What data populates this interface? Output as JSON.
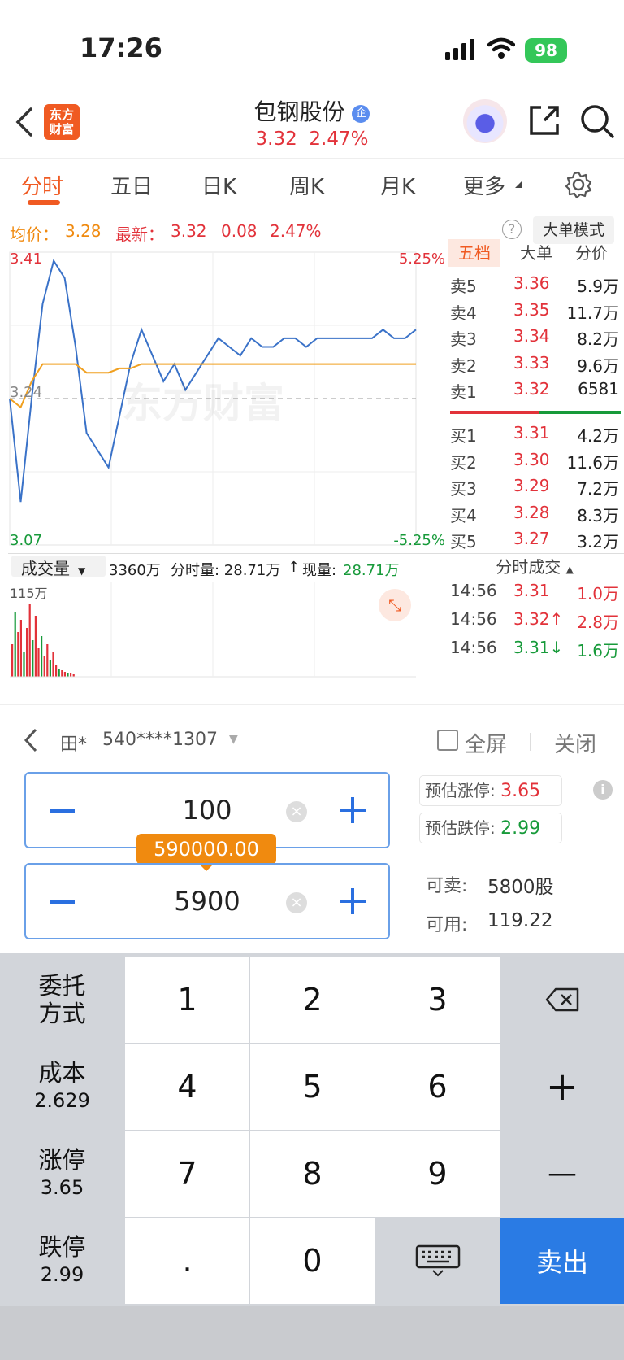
{
  "status_bar": {
    "time": "17:26",
    "battery": "98"
  },
  "header": {
    "logo": "东方财富",
    "title": "包钢股份",
    "badge": "企",
    "price": "3.32",
    "change_pct": "2.47%"
  },
  "tabs": [
    "分时",
    "五日",
    "日K",
    "周K",
    "月K",
    "更多"
  ],
  "info_bar": {
    "avg_label": "均价：",
    "avg_value": "3.28",
    "latest_label": "最新：",
    "latest_value": "3.32",
    "change": "0.08",
    "change_pct": "2.47%",
    "mode_button": "大单模式"
  },
  "chart_data": {
    "type": "line",
    "y_high": "3.41",
    "y_mid": "3.24",
    "y_low": "3.07",
    "pct_high": "5.25%",
    "pct_low": "-5.25%",
    "watermark": "东方财富",
    "ylim": [
      3.07,
      3.41
    ],
    "series": [
      {
        "values": [
          3.24,
          3.12,
          3.24,
          3.35,
          3.4,
          3.38,
          3.3,
          3.2,
          3.18,
          3.16,
          3.22,
          3.28,
          3.32,
          3.29,
          3.26,
          3.28,
          3.25,
          3.27,
          3.29,
          3.31,
          3.3,
          3.29,
          3.31,
          3.3,
          3.3,
          3.31,
          3.31,
          3.3,
          3.31,
          3.31,
          3.31,
          3.31,
          3.31,
          3.31,
          3.32,
          3.31,
          3.31,
          3.32
        ]
      },
      {
        "values": [
          3.24,
          3.23,
          3.26,
          3.28,
          3.28,
          3.28,
          3.28,
          3.27,
          3.27,
          3.27,
          3.275,
          3.275,
          3.28,
          3.28,
          3.28,
          3.28,
          3.28,
          3.28,
          3.28,
          3.28,
          3.28,
          3.28,
          3.28,
          3.28,
          3.28,
          3.28,
          3.28,
          3.28,
          3.28,
          3.28,
          3.28,
          3.28,
          3.28,
          3.28,
          3.28,
          3.28,
          3.28,
          3.28
        ]
      }
    ],
    "volume_label": "成交量",
    "volume_total": "3360万",
    "volume_period": "分时量: 28.71万",
    "volume_now_label": "现量:",
    "volume_now": "28.71万",
    "volume_max": "115万",
    "volume_values": [
      40,
      80,
      55,
      70,
      30,
      60,
      90,
      45,
      75,
      35,
      50,
      25,
      40,
      20,
      30,
      15,
      10,
      8,
      6,
      5,
      4,
      3
    ]
  },
  "orderbook": {
    "tabs": [
      "五档",
      "大单",
      "分价"
    ],
    "asks": [
      {
        "label": "卖5",
        "price": "3.36",
        "vol": "5.9万"
      },
      {
        "label": "卖4",
        "price": "3.35",
        "vol": "11.7万"
      },
      {
        "label": "卖3",
        "price": "3.34",
        "vol": "8.2万"
      },
      {
        "label": "卖2",
        "price": "3.33",
        "vol": "9.6万"
      },
      {
        "label": "卖1",
        "price": "3.32",
        "vol": "6581"
      }
    ],
    "bids": [
      {
        "label": "买1",
        "price": "3.31",
        "vol": "4.2万"
      },
      {
        "label": "买2",
        "price": "3.30",
        "vol": "11.6万"
      },
      {
        "label": "买3",
        "price": "3.29",
        "vol": "7.2万"
      },
      {
        "label": "买4",
        "price": "3.28",
        "vol": "8.3万"
      },
      {
        "label": "买5",
        "price": "3.27",
        "vol": "3.2万"
      }
    ],
    "ticks_title": "分时成交",
    "ticks": [
      {
        "time": "14:56",
        "price": "3.31",
        "vol": "1.0万"
      },
      {
        "time": "14:56",
        "price": "3.32↑",
        "vol": "2.8万"
      },
      {
        "time": "14:56",
        "price": "3.31↓",
        "vol": "1.6万"
      }
    ]
  },
  "trade_panel": {
    "account_name": "田*",
    "account_no": "540****1307",
    "fullscreen": "全屏",
    "close": "关闭",
    "price_input": "100",
    "qty_input": "5900",
    "amount_tip": "590000.00",
    "limit_up_label": "预估涨停:",
    "limit_up": "3.65",
    "limit_down_label": "预估跌停:",
    "limit_down": "2.99",
    "sellable_label": "可卖:",
    "sellable": "5800股",
    "available_label": "可用:",
    "available": "119.22"
  },
  "keypad": {
    "keys": [
      "1",
      "2",
      "3",
      "4",
      "5",
      "6",
      "7",
      "8",
      "9",
      ".",
      "0"
    ],
    "order_type": [
      "委托",
      "方式"
    ],
    "cost_label": "成本",
    "cost": "2.629",
    "up_label": "涨停",
    "up": "3.65",
    "down_label": "跌停",
    "down": "2.99",
    "plus": "+",
    "minus": "—",
    "sell": "卖出"
  },
  "colors": {
    "up": "#e2323a",
    "down": "#179a3a",
    "accent": "#f05a22",
    "keypad_blue": "#2a7be4",
    "price_line": "#3a72c8",
    "avg_line": "#f0a020"
  }
}
